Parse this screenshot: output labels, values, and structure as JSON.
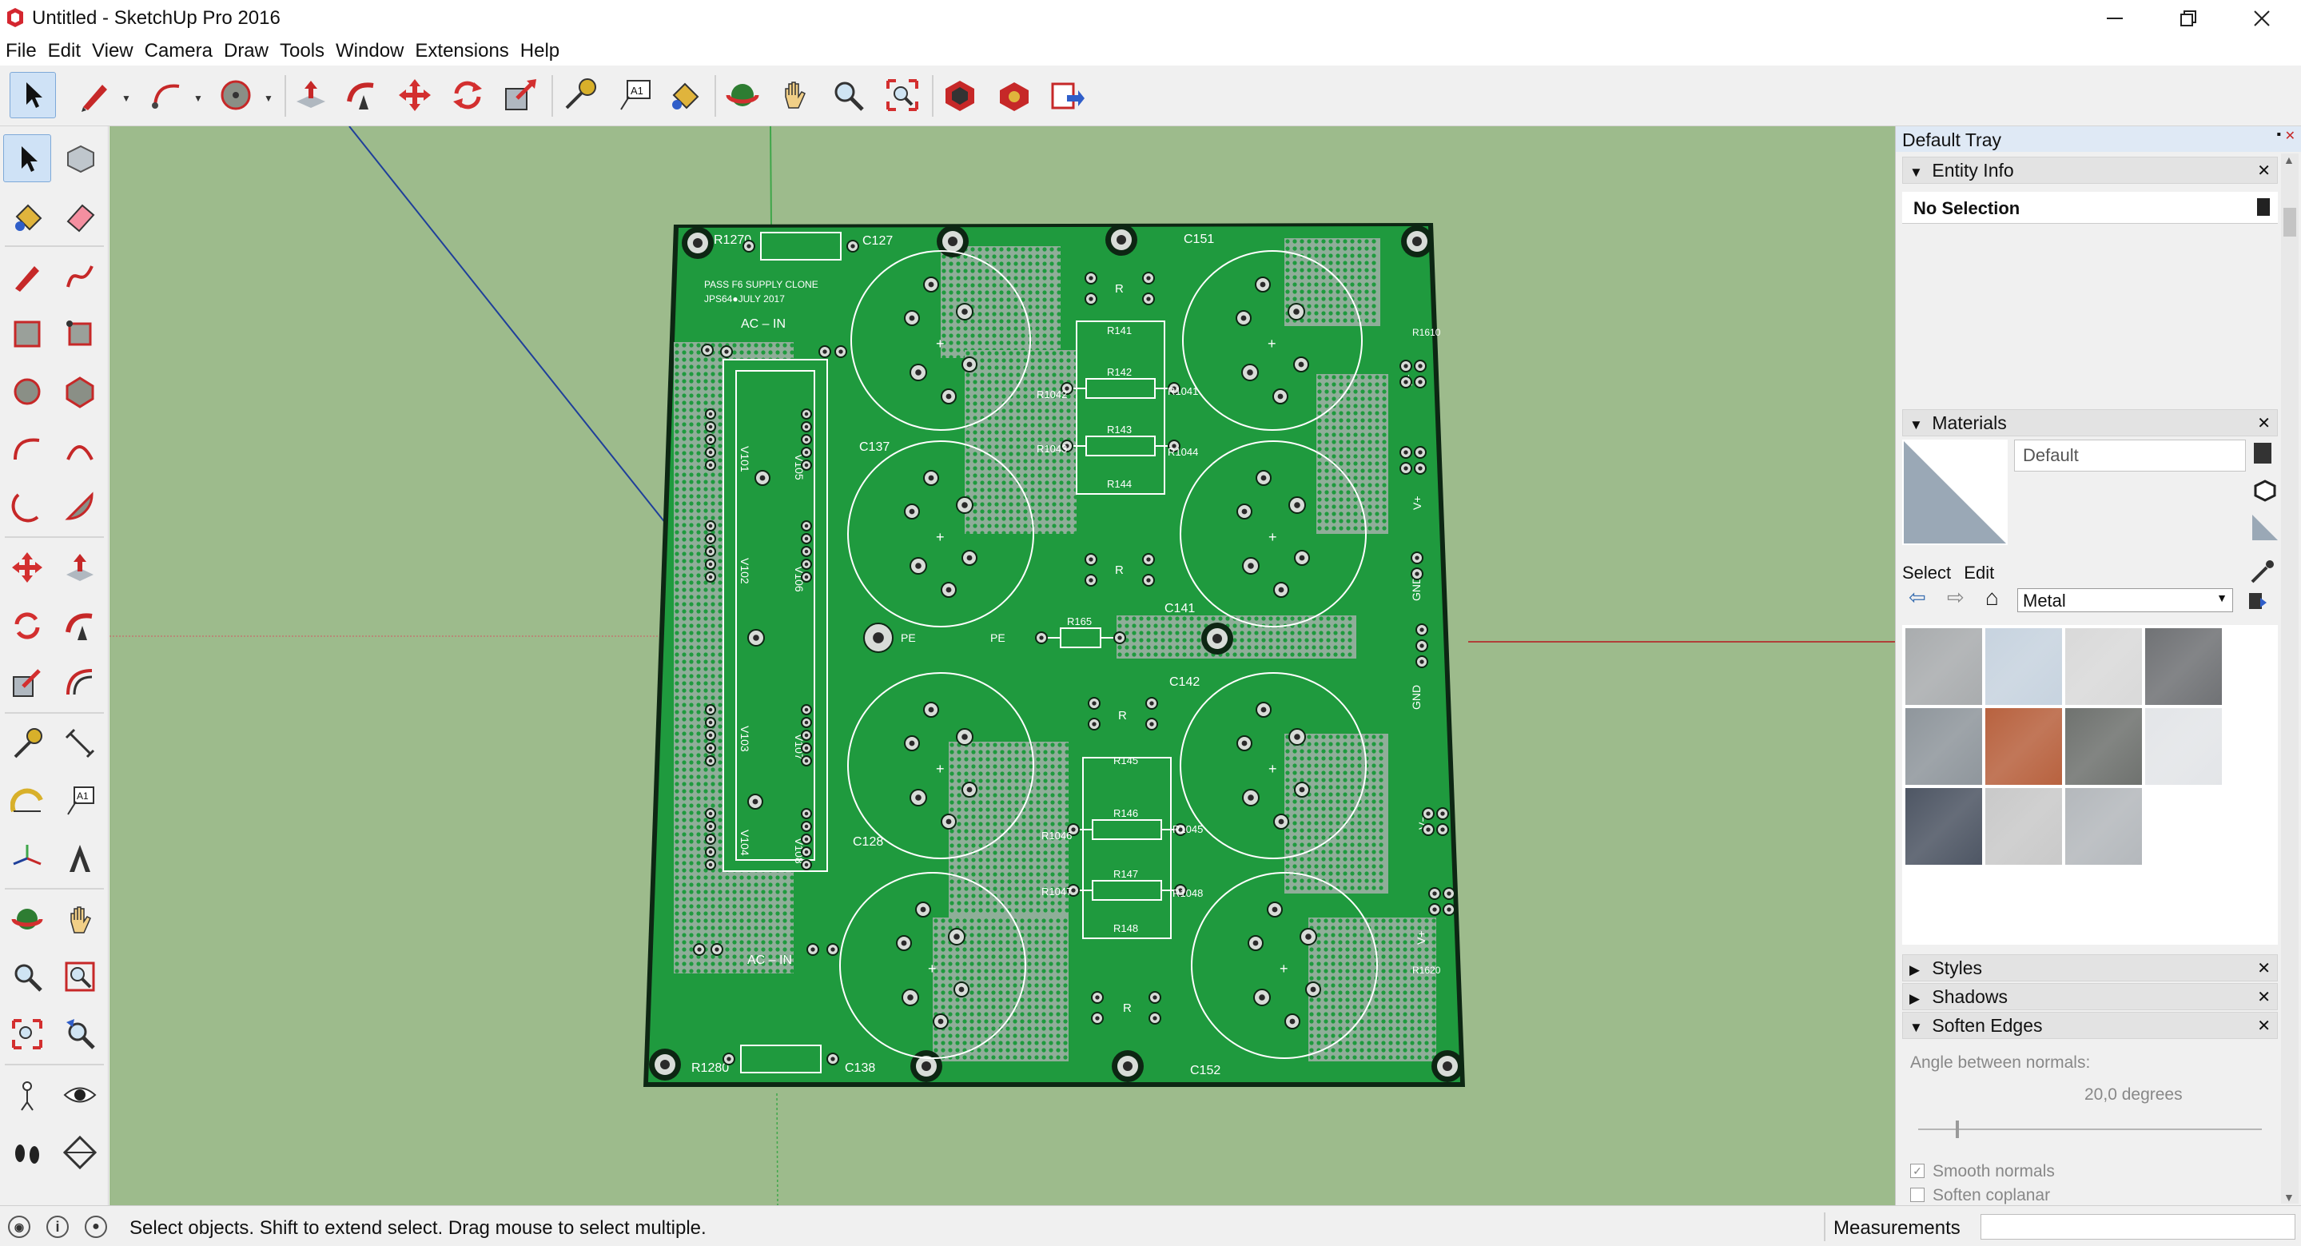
{
  "window": {
    "title": "Untitled - SketchUp Pro 2016",
    "controls": [
      "minimize",
      "restore",
      "close"
    ]
  },
  "menu": [
    "File",
    "Edit",
    "View",
    "Camera",
    "Draw",
    "Tools",
    "Window",
    "Extensions",
    "Help"
  ],
  "top_toolbar": [
    "select-icon",
    "pencil-line-icon",
    "freehand-arc-icon",
    "circle-icon",
    "push-pull-icon",
    "follow-me-icon",
    "move-icon",
    "rotate-icon",
    "scale-icon",
    "tape-measure-icon",
    "text-icon",
    "paint-bucket-icon",
    "orbit-icon",
    "pan-icon",
    "zoom-icon",
    "zoom-extents-icon",
    "warehouse-icon",
    "extension-warehouse-icon",
    "send-to-layout-icon"
  ],
  "left_toolbar": [
    "select-icon",
    "make-component-icon",
    "paint-bucket-icon",
    "eraser-icon",
    "line-icon",
    "freehand-icon",
    "rectangle-icon",
    "rotated-rectangle-icon",
    "circle-icon",
    "polygon-icon",
    "arc-icon",
    "two-point-arc-icon",
    "three-point-arc-icon",
    "pie-icon",
    "move-icon",
    "push-pull-icon",
    "rotate-icon",
    "follow-me-icon",
    "scale-icon",
    "offset-icon",
    "tape-measure-icon",
    "dimension-icon",
    "protractor-icon",
    "text-icon",
    "axes-icon",
    "3d-text-icon",
    "orbit-icon",
    "pan-icon",
    "zoom-icon",
    "zoom-window-icon",
    "zoom-extents-icon",
    "previous-view-icon",
    "position-camera-icon",
    "look-around-icon",
    "walk-icon",
    "section-plane-icon"
  ],
  "pcb": {
    "title_line1": "PASS F6 SUPPLY CLONE",
    "title_line2": "JPS64●JULY 2017",
    "ac_in": "AC – IN",
    "pe": "PE",
    "gnd": "GND",
    "v_plus": "V+",
    "v_minus": "V−",
    "r": "R",
    "labels": {
      "r1270": "R1270",
      "c127": "C127",
      "c151": "C151",
      "c137": "C137",
      "c141": "C141",
      "c142": "C142",
      "c128": "C128",
      "c138": "C138",
      "c152": "C152",
      "r1280": "R1280",
      "r141": "R141",
      "r142": "R142",
      "r143": "R143",
      "r144": "R144",
      "r145": "R145",
      "r146": "R146",
      "r147": "R147",
      "r148": "R148",
      "r165": "R165",
      "r1041": "R1041",
      "r1042": "R1042",
      "r1043": "R1043",
      "r1044": "R1044",
      "r1045": "R1045",
      "r1046": "R1046",
      "r1047": "R1047",
      "r1048": "R1048",
      "r1610": "R1610",
      "r1620": "R1620",
      "v101": "V101",
      "v102": "V102",
      "v103": "V103",
      "v104": "V104",
      "v105": "V105",
      "v106": "V106",
      "v107": "V107",
      "v108": "V108"
    }
  },
  "tray": {
    "title": "Default Tray",
    "entity_info": {
      "header": "Entity Info",
      "selection": "No Selection"
    },
    "materials": {
      "header": "Materials",
      "current_name": "Default",
      "tab_select": "Select",
      "tab_edit": "Edit",
      "library": "Metal",
      "swatch_colors": [
        "#a9acae",
        "#c7d3df",
        "#d9d9d9",
        "#707275",
        "#8f969c",
        "#b8623f",
        "#6f726f",
        "#e3e5e8",
        "#4e5664",
        "#c9c9c9",
        "#b4b8bc"
      ]
    },
    "styles": "Styles",
    "shadows": "Shadows",
    "soften_edges": {
      "header": "Soften Edges",
      "angle_label": "Angle between normals:",
      "angle_value": "20,0  degrees",
      "angle": 20,
      "smooth_normals": "Smooth normals",
      "soften_coplanar": "Soften coplanar",
      "smooth_checked": true,
      "coplanar_checked": false
    }
  },
  "status": {
    "message": "Select objects. Shift to extend select. Drag mouse to select multiple.",
    "measurements_label": "Measurements",
    "measurements_value": ""
  },
  "colors": {
    "viewport_bg": "#9dbb8c",
    "pcb_green": "#1f9a3e",
    "silkscreen": "#ffffff",
    "axis_red": "#b0403a",
    "axis_green": "#3fa64a",
    "axis_blue": "#1f3f9a"
  }
}
